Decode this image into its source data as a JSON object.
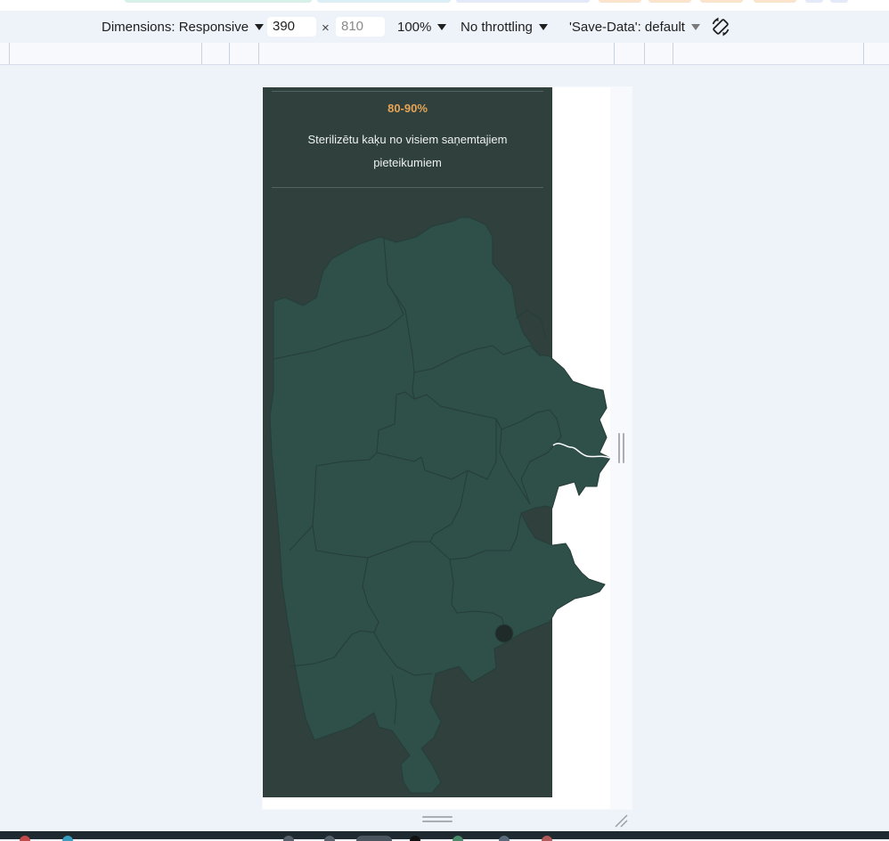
{
  "devtools": {
    "dimensions_label": "Dimensions: Responsive",
    "width_value": "390",
    "times_symbol": "×",
    "height_placeholder": "810",
    "zoom_label": "100%",
    "throttling_label": "No throttling",
    "save_data_label": "'Save-Data': default",
    "rotate_icon": "rotate-icon"
  },
  "page": {
    "stat_value": "80-90%",
    "stat_description": "Sterilizētu kaķu no visiem saņemtajiem pieteikumiem",
    "map_icon": "region-map",
    "marker_icon": "location-marker-icon"
  },
  "colors": {
    "panel_bg": "#2f403d",
    "map_fill": "#2f4f49",
    "accent": "#e6a556",
    "devtools_bg": "#eef2f9"
  }
}
